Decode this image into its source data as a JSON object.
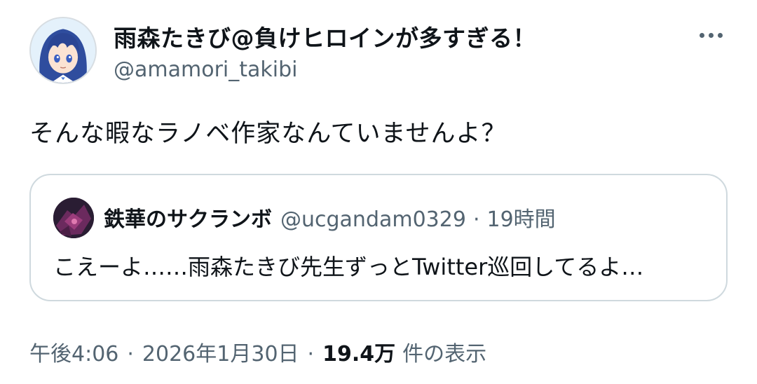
{
  "author": {
    "display_name": "雨森たきび@負けヒロインが多すぎる！",
    "handle": "@amamori_takibi",
    "avatar_icon": "anime-girl-avatar-icon"
  },
  "more_icon": "more-horizontal-icon",
  "tweet": {
    "text": "そんな暇なラノベ作家なんていませんよ？"
  },
  "quoted": {
    "display_name": "鉄華のサクランボ",
    "handle": "@ucgandam0329",
    "separator": "·",
    "time": "19時間",
    "text": "こえーよ……雨森たきび先生ずっとTwitter巡回してるよ…",
    "avatar_icon": "dark-robot-avatar-icon"
  },
  "meta": {
    "time": "午後4:06",
    "separator": "·",
    "date": "2026年1月30日",
    "views_count": "19.4万",
    "views_label": "件の表示"
  },
  "colors": {
    "text_primary": "#0f1419",
    "text_secondary": "#536471",
    "border": "#cfd9de"
  }
}
